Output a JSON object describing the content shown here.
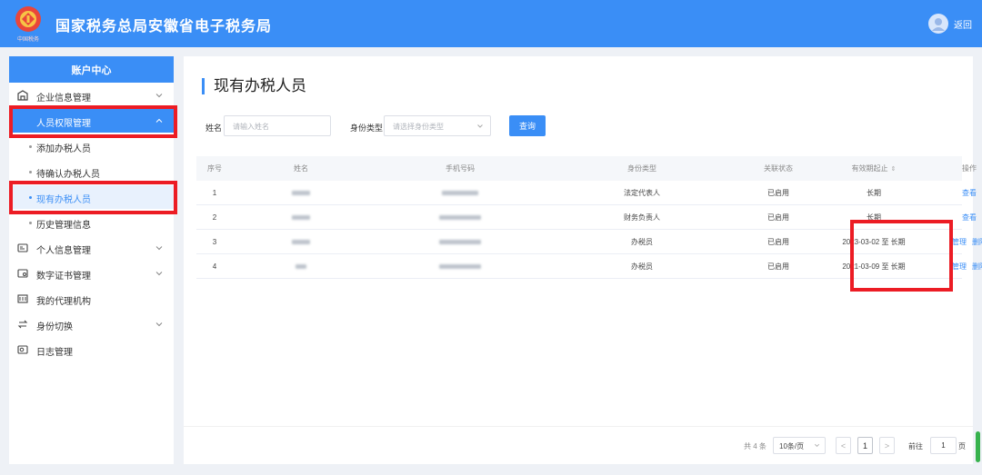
{
  "header": {
    "title": "国家税务总局安徽省电子税务局",
    "back_label": "返回",
    "emblem_caption": "中国税务"
  },
  "sidebar": {
    "heading": "账户中心",
    "items": [
      {
        "label": "企业信息管理"
      },
      {
        "label": "人员权限管理"
      },
      {
        "label": "个人信息管理"
      },
      {
        "label": "数字证书管理"
      },
      {
        "label": "我的代理机构"
      },
      {
        "label": "身份切换"
      },
      {
        "label": "日志管理"
      }
    ],
    "subitems": [
      {
        "label": "添加办税人员"
      },
      {
        "label": "待确认办税人员"
      },
      {
        "label": "现有办税人员"
      },
      {
        "label": "历史管理信息"
      }
    ]
  },
  "main": {
    "title": "现有办税人员",
    "filters": {
      "name_label": "姓名",
      "name_placeholder": "请输入姓名",
      "type_label": "身份类型",
      "type_placeholder": "请选择身份类型",
      "query_label": "查询"
    },
    "table": {
      "headers": [
        "序号",
        "姓名",
        "手机号码",
        "身份类型",
        "关联状态",
        "有效期起止",
        "操作"
      ],
      "rows": [
        {
          "idx": "1",
          "type": "法定代表人",
          "status": "已启用",
          "period": "长期",
          "ops": [
            "查看"
          ]
        },
        {
          "idx": "2",
          "type": "财务负责人",
          "status": "已启用",
          "period": "长期",
          "ops": [
            "查看"
          ]
        },
        {
          "idx": "3",
          "type": "办税员",
          "status": "已启用",
          "period": "2023-03-02 至 长期",
          "ops": [
            "管理",
            "删除"
          ]
        },
        {
          "idx": "4",
          "type": "办税员",
          "status": "已启用",
          "period": "2021-03-09 至 长期",
          "ops": [
            "管理",
            "删除"
          ]
        }
      ]
    },
    "pagination": {
      "total": "共 4 条",
      "page_size": "10条/页",
      "prev": "<",
      "current": "1",
      "next": ">",
      "goto_label": "前往",
      "goto_value": "1",
      "goto_unit": "页"
    }
  },
  "colors": {
    "accent": "#3a8ef6",
    "highlight": "#ec1c24"
  }
}
